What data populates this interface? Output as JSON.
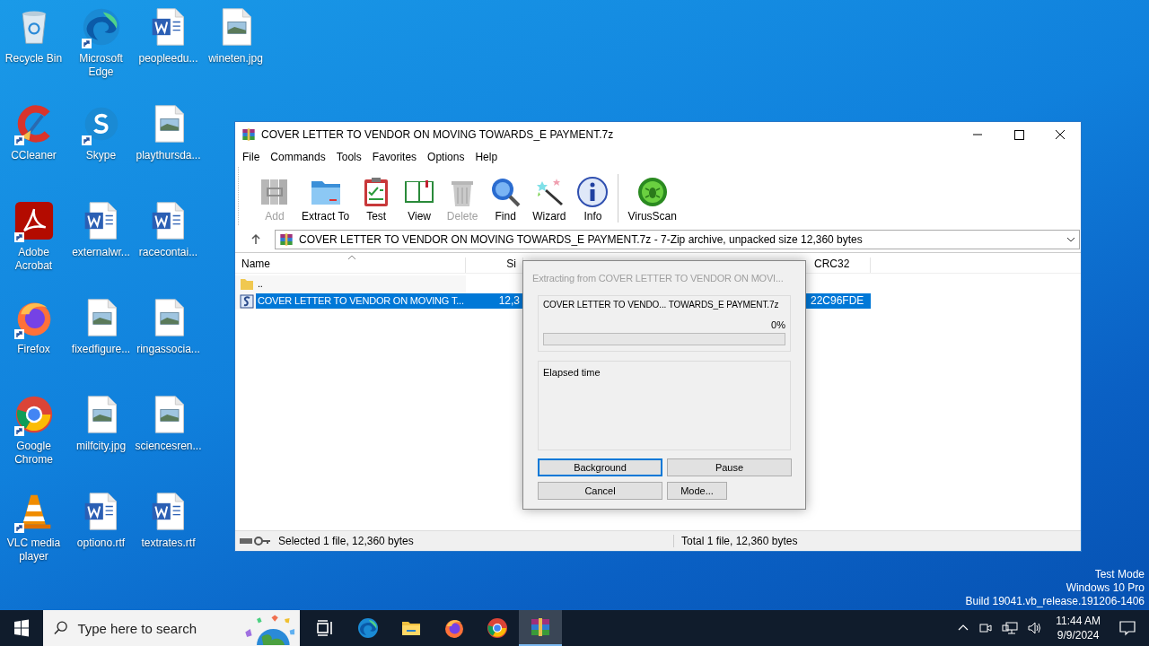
{
  "desktop": {
    "icons": [
      {
        "label": "Recycle Bin",
        "kind": "recycle-bin",
        "shortcut": false
      },
      {
        "label": "CCleaner",
        "kind": "ccleaner",
        "shortcut": true
      },
      {
        "label": "Adobe Acrobat",
        "kind": "acrobat",
        "shortcut": true
      },
      {
        "label": "Firefox",
        "kind": "firefox",
        "shortcut": true
      },
      {
        "label": "Google Chrome",
        "kind": "chrome",
        "shortcut": true
      },
      {
        "label": "VLC media player",
        "kind": "vlc",
        "shortcut": true
      },
      {
        "label": "Microsoft Edge",
        "kind": "edge",
        "shortcut": true
      },
      {
        "label": "Skype",
        "kind": "skype",
        "shortcut": true
      },
      {
        "label": "externalwr...",
        "kind": "word",
        "shortcut": false
      },
      {
        "label": "fixedfigure...",
        "kind": "image",
        "shortcut": false
      },
      {
        "label": "milfcity.jpg",
        "kind": "image",
        "shortcut": false
      },
      {
        "label": "optiono.rtf",
        "kind": "word",
        "shortcut": false
      },
      {
        "label": "peopleedu...",
        "kind": "word",
        "shortcut": false
      },
      {
        "label": "playthursda...",
        "kind": "image",
        "shortcut": false
      },
      {
        "label": "racecontai...",
        "kind": "word",
        "shortcut": false
      },
      {
        "label": "ringassocia...",
        "kind": "image",
        "shortcut": false
      },
      {
        "label": "sciencesren...",
        "kind": "image",
        "shortcut": false
      },
      {
        "label": "textrates.rtf",
        "kind": "word",
        "shortcut": false
      },
      {
        "label": "wineten.jpg",
        "kind": "image",
        "shortcut": false
      }
    ],
    "watermark": [
      "Test Mode",
      "Windows 10 Pro",
      "Build 19041.vb_release.191206-1406"
    ]
  },
  "window": {
    "title": "COVER LETTER TO VENDOR ON MOVING TOWARDS_E PAYMENT.7z",
    "menu": [
      "File",
      "Commands",
      "Tools",
      "Favorites",
      "Options",
      "Help"
    ],
    "toolbar": [
      {
        "label": "Add",
        "kind": "add",
        "disabled": true
      },
      {
        "label": "Extract To",
        "kind": "extract",
        "disabled": false
      },
      {
        "label": "Test",
        "kind": "test",
        "disabled": false
      },
      {
        "label": "View",
        "kind": "view",
        "disabled": false
      },
      {
        "label": "Delete",
        "kind": "delete",
        "disabled": true
      },
      {
        "label": "Find",
        "kind": "find",
        "disabled": false
      },
      {
        "label": "Wizard",
        "kind": "wizard",
        "disabled": false
      },
      {
        "label": "Info",
        "kind": "info",
        "disabled": false
      },
      {
        "label": "VirusScan",
        "kind": "virusscan",
        "disabled": false
      }
    ],
    "address": "COVER LETTER TO VENDOR ON MOVING TOWARDS_E PAYMENT.7z - 7-Zip archive, unpacked size 12,360 bytes",
    "columns": [
      "Name",
      "Si",
      "CRC32"
    ],
    "rows": [
      {
        "kind": "folder",
        "name": "..",
        "size": "",
        "crc": "",
        "selected": false
      },
      {
        "kind": "file",
        "name": "COVER LETTER TO VENDOR ON MOVING T...",
        "size": "12,3",
        "crc": "22C96FDE",
        "selected": true
      }
    ],
    "status_left": "Selected 1 file, 12,360 bytes",
    "status_right": "Total 1 file, 12,360 bytes"
  },
  "dialog": {
    "title": "Extracting from COVER LETTER TO VENDOR ON MOVI...",
    "file": "COVER LETTER TO VENDO... TOWARDS_E PAYMENT.7z",
    "percent": "0%",
    "level": 0,
    "elapsed_label": "Elapsed time",
    "buttons": [
      {
        "label": "Background",
        "focused": true
      },
      {
        "label": "Pause",
        "focused": false
      },
      {
        "label": "Cancel",
        "focused": false
      },
      {
        "label": "Mode...",
        "focused": false
      }
    ]
  },
  "taskbar": {
    "search_placeholder": "Type here to search",
    "apps": [
      {
        "kind": "task-view",
        "active": false
      },
      {
        "kind": "edge",
        "active": false
      },
      {
        "kind": "folder",
        "active": false
      },
      {
        "kind": "firefox",
        "active": false
      },
      {
        "kind": "chrome",
        "active": false
      },
      {
        "kind": "winrar",
        "active": true
      }
    ],
    "time": "11:44 AM",
    "date": "9/9/2024"
  }
}
